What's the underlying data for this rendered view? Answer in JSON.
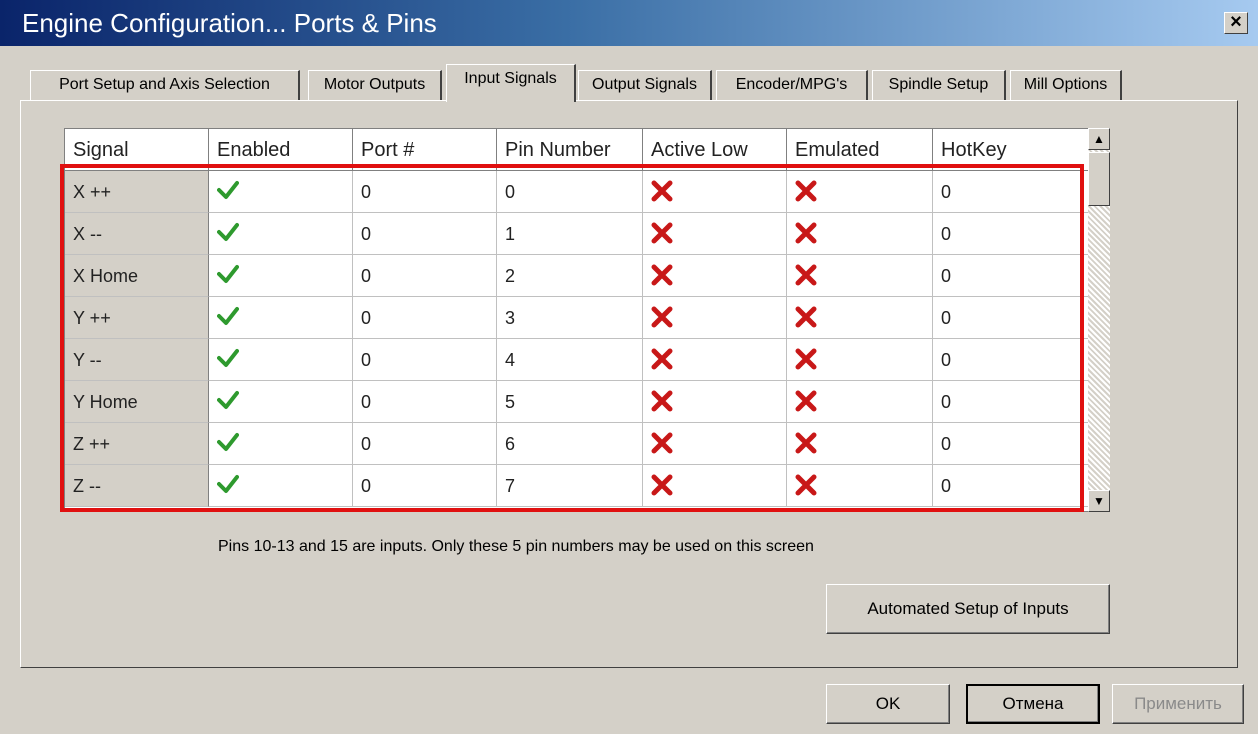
{
  "window": {
    "title": "Engine Configuration... Ports & Pins",
    "close_label": "×"
  },
  "tabs": [
    {
      "label": "Port Setup and Axis Selection",
      "active": false
    },
    {
      "label": "Motor Outputs",
      "active": false
    },
    {
      "label": "Input Signals",
      "active": true
    },
    {
      "label": "Output Signals",
      "active": false
    },
    {
      "label": "Encoder/MPG's",
      "active": false
    },
    {
      "label": "Spindle Setup",
      "active": false
    },
    {
      "label": "Mill Options",
      "active": false
    }
  ],
  "table": {
    "columns": [
      "Signal",
      "Enabled",
      "Port #",
      "Pin Number",
      "Active Low",
      "Emulated",
      "HotKey"
    ],
    "rows": [
      {
        "signal": "X ++",
        "enabled": true,
        "port": "0",
        "pin": "0",
        "active_low": false,
        "emulated": false,
        "hotkey": "0"
      },
      {
        "signal": "X --",
        "enabled": true,
        "port": "0",
        "pin": "1",
        "active_low": false,
        "emulated": false,
        "hotkey": "0"
      },
      {
        "signal": "X Home",
        "enabled": true,
        "port": "0",
        "pin": "2",
        "active_low": false,
        "emulated": false,
        "hotkey": "0"
      },
      {
        "signal": "Y ++",
        "enabled": true,
        "port": "0",
        "pin": "3",
        "active_low": false,
        "emulated": false,
        "hotkey": "0"
      },
      {
        "signal": "Y --",
        "enabled": true,
        "port": "0",
        "pin": "4",
        "active_low": false,
        "emulated": false,
        "hotkey": "0"
      },
      {
        "signal": "Y Home",
        "enabled": true,
        "port": "0",
        "pin": "5",
        "active_low": false,
        "emulated": false,
        "hotkey": "0"
      },
      {
        "signal": "Z ++",
        "enabled": true,
        "port": "0",
        "pin": "6",
        "active_low": false,
        "emulated": false,
        "hotkey": "0"
      },
      {
        "signal": "Z --",
        "enabled": true,
        "port": "0",
        "pin": "7",
        "active_low": false,
        "emulated": false,
        "hotkey": "0"
      }
    ]
  },
  "note": "Pins 10-13 and 15 are inputs. Only these 5 pin numbers may be used on this screen",
  "buttons": {
    "auto_setup": "Automated Setup of Inputs",
    "ok": "OK",
    "cancel": "Отмена",
    "apply": "Применить"
  },
  "colors": {
    "title_gradient_start": "#0a246a",
    "title_gradient_end": "#a6caf0",
    "highlight": "#e01010",
    "check": "#2e9a2e",
    "cross": "#c81818"
  },
  "icons": {
    "enabled_true": "green-check-icon",
    "flag_false": "red-x-icon"
  }
}
